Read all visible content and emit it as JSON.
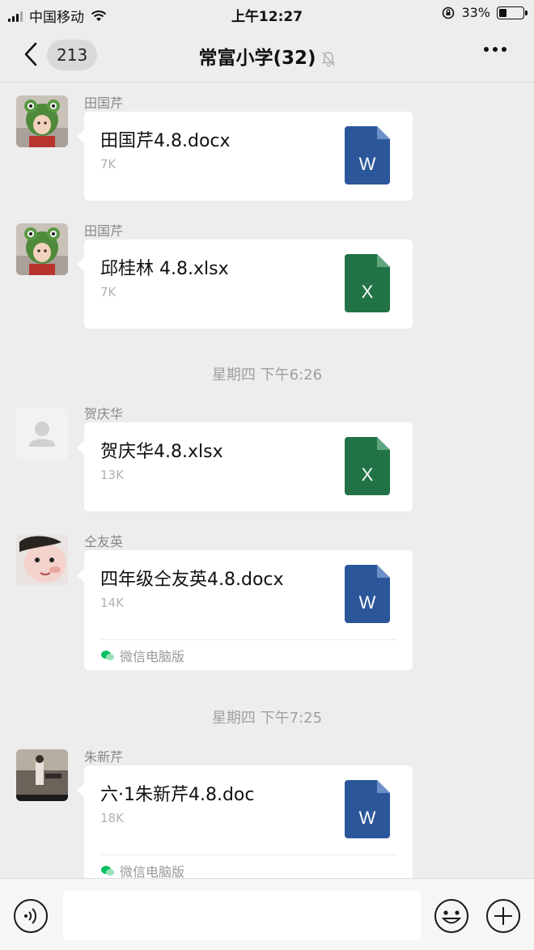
{
  "status_bar": {
    "carrier": "中国移动",
    "time": "上午12:27",
    "battery": "33%",
    "battery_level": 0.33
  },
  "nav": {
    "back_icon": "chevron-left-icon",
    "unread_count": "213",
    "title": "常富小学(32)",
    "mute_icon": "bell-off-icon",
    "more_icon": "ellipsis-icon"
  },
  "messages": [
    {
      "sender": "田国芹",
      "avatar": "frog-hat-child-photo",
      "file_name": "田国芹4.8.docx",
      "file_size": "7K",
      "file_type": "word",
      "file_letter": "W",
      "footer": ""
    },
    {
      "sender": "田国芹",
      "avatar": "frog-hat-child-photo",
      "file_name": "邱桂林 4.8.xlsx",
      "file_size": "7K",
      "file_type": "excel",
      "file_letter": "X",
      "footer": ""
    },
    {
      "sender": "贺庆华",
      "avatar": "default-user-avatar",
      "file_name": "贺庆华4.8.xlsx",
      "file_size": "13K",
      "file_type": "excel",
      "file_letter": "X",
      "footer": ""
    },
    {
      "sender": "仝友英",
      "avatar": "child-face-photo",
      "file_name": "四年级仝友英4.8.docx",
      "file_size": "14K",
      "file_type": "word",
      "file_letter": "W",
      "footer": "微信电脑版"
    },
    {
      "sender": "朱新芹",
      "avatar": "outdoor-photo",
      "file_name": "六·1朱新芹4.8.doc",
      "file_size": "18K",
      "file_type": "word",
      "file_letter": "W",
      "footer": "微信电脑版"
    }
  ],
  "timestamps": [
    "星期四 下午6:26",
    "星期四 下午7:25"
  ],
  "colors": {
    "word": "#2b579a",
    "excel": "#217346",
    "background": "#ededed",
    "wechat_green": "#07c160"
  },
  "input_bar": {
    "voice_icon": "voice-icon",
    "emoji_icon": "emoji-icon",
    "plus_icon": "plus-circle-icon"
  }
}
